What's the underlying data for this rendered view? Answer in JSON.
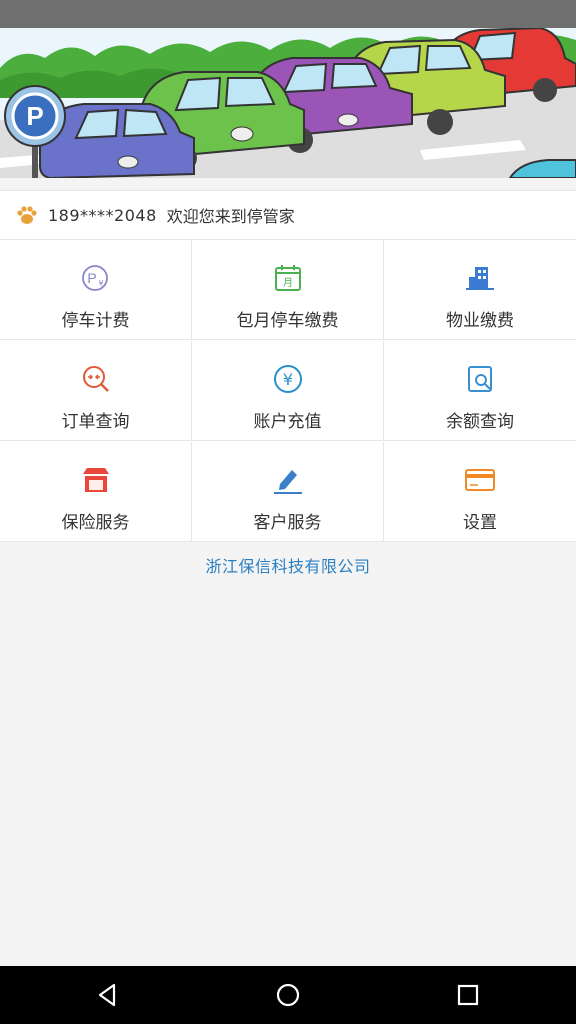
{
  "welcome": {
    "phone": "189****2048",
    "message": "欢迎您来到停管家",
    "icon": "paw-icon"
  },
  "menu": [
    {
      "id": "parking-fee",
      "label": "停车计费",
      "icon": "parking-fee-icon",
      "color": "#8a84c9"
    },
    {
      "id": "monthly-parking",
      "label": "包月停车缴费",
      "icon": "calendar-icon",
      "color": "#4caf50"
    },
    {
      "id": "property-fee",
      "label": "物业缴费",
      "icon": "building-icon",
      "color": "#3b7bd4"
    },
    {
      "id": "order-query",
      "label": "订单查询",
      "icon": "order-search-icon",
      "color": "#e05a3a"
    },
    {
      "id": "account-recharge",
      "label": "账户充值",
      "icon": "yen-icon",
      "color": "#2a8fc7"
    },
    {
      "id": "balance-query",
      "label": "余额查询",
      "icon": "document-search-icon",
      "color": "#3a8fd0"
    },
    {
      "id": "insurance",
      "label": "保险服务",
      "icon": "shop-icon",
      "color": "#e8473a"
    },
    {
      "id": "customer-service",
      "label": "客户服务",
      "icon": "edit-icon",
      "color": "#3a7fc8"
    },
    {
      "id": "settings",
      "label": "设置",
      "icon": "card-icon",
      "color": "#f08a24"
    }
  ],
  "footer": {
    "company": "浙江保信科技有限公司"
  },
  "navbar": {
    "back": "back-icon",
    "home": "home-icon",
    "recents": "recents-icon"
  }
}
